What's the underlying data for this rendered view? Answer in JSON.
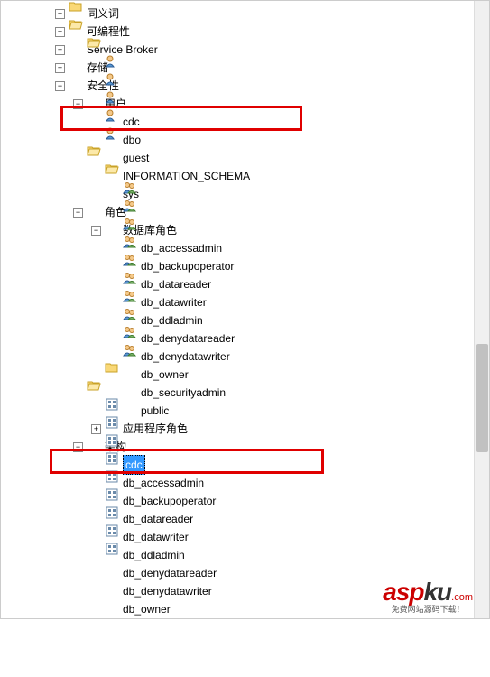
{
  "tree": {
    "n0": "同义词",
    "n1": "可编程性",
    "n2": "Service Broker",
    "n3": "存储",
    "n4": "安全性",
    "n5": "用户",
    "u0": "cdc",
    "u1": "dbo",
    "u2": "guest",
    "u3": "INFORMATION_SCHEMA",
    "u4": "sys",
    "n6": "角色",
    "n7": "数据库角色",
    "r0": "db_accessadmin",
    "r1": "db_backupoperator",
    "r2": "db_datareader",
    "r3": "db_datawriter",
    "r4": "db_ddladmin",
    "r5": "db_denydatareader",
    "r6": "db_denydatawriter",
    "r7": "db_owner",
    "r8": "db_securityadmin",
    "r9": "public",
    "n8": "应用程序角色",
    "n9": "架构",
    "s0": "cdc",
    "s1": "db_accessadmin",
    "s2": "db_backupoperator",
    "s3": "db_datareader",
    "s4": "db_datawriter",
    "s5": "db_ddladmin",
    "s6": "db_denydatareader",
    "s7": "db_denydatawriter",
    "s8": "db_owner"
  },
  "watermark": {
    "asp": "asp",
    "ku": "ku",
    "com": ".com",
    "cn": "免费网站源码下载！"
  }
}
